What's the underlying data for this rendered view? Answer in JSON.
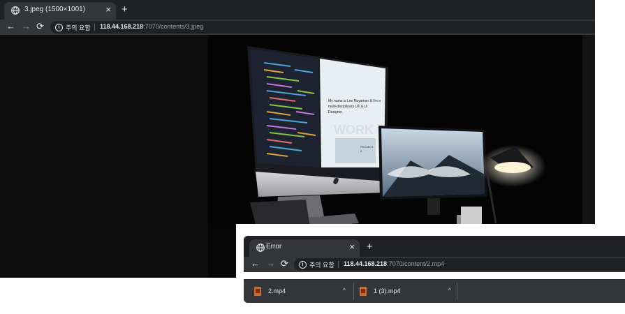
{
  "window1": {
    "tab": {
      "title": "3.jpeg (1500×1001)",
      "close": "×"
    },
    "new_tab": "+",
    "toolbar": {
      "back": "←",
      "forward": "→",
      "reload": "⟳"
    },
    "omnibox": {
      "info_icon": "i",
      "security_label": "주의 요함",
      "url_host": "118.44.168.218",
      "url_path": ":7070/contents/3.jpeg"
    },
    "image": {
      "alt_description_icon": "photo-of-desk-with-monitors",
      "screen_text": [
        "My name is Lee Rayaman & I'm a",
        "multi-disciplinary UX & UI",
        "Designer.",
        "WORK",
        "PROJECT",
        "ft"
      ]
    }
  },
  "window2": {
    "tab": {
      "title": "Error",
      "close": "×"
    },
    "new_tab": "+",
    "toolbar": {
      "back": "←",
      "forward": "→",
      "reload": "⟳"
    },
    "omnibox": {
      "info_icon": "i",
      "security_label": "주의 요함",
      "url_host": "118.44.168.218",
      "url_path": ":7070/content/2.mp4"
    },
    "downloads": [
      {
        "name": "2.mp4",
        "chevron": "^"
      },
      {
        "name": "1 (3).mp4",
        "chevron": "^"
      }
    ]
  },
  "colors": {
    "tab_strip": "#202124",
    "active_tab": "#35363a",
    "url_host_text": "#e8eaed",
    "url_path_text": "#9aa0a6",
    "download_icon": "#d06a2a"
  }
}
